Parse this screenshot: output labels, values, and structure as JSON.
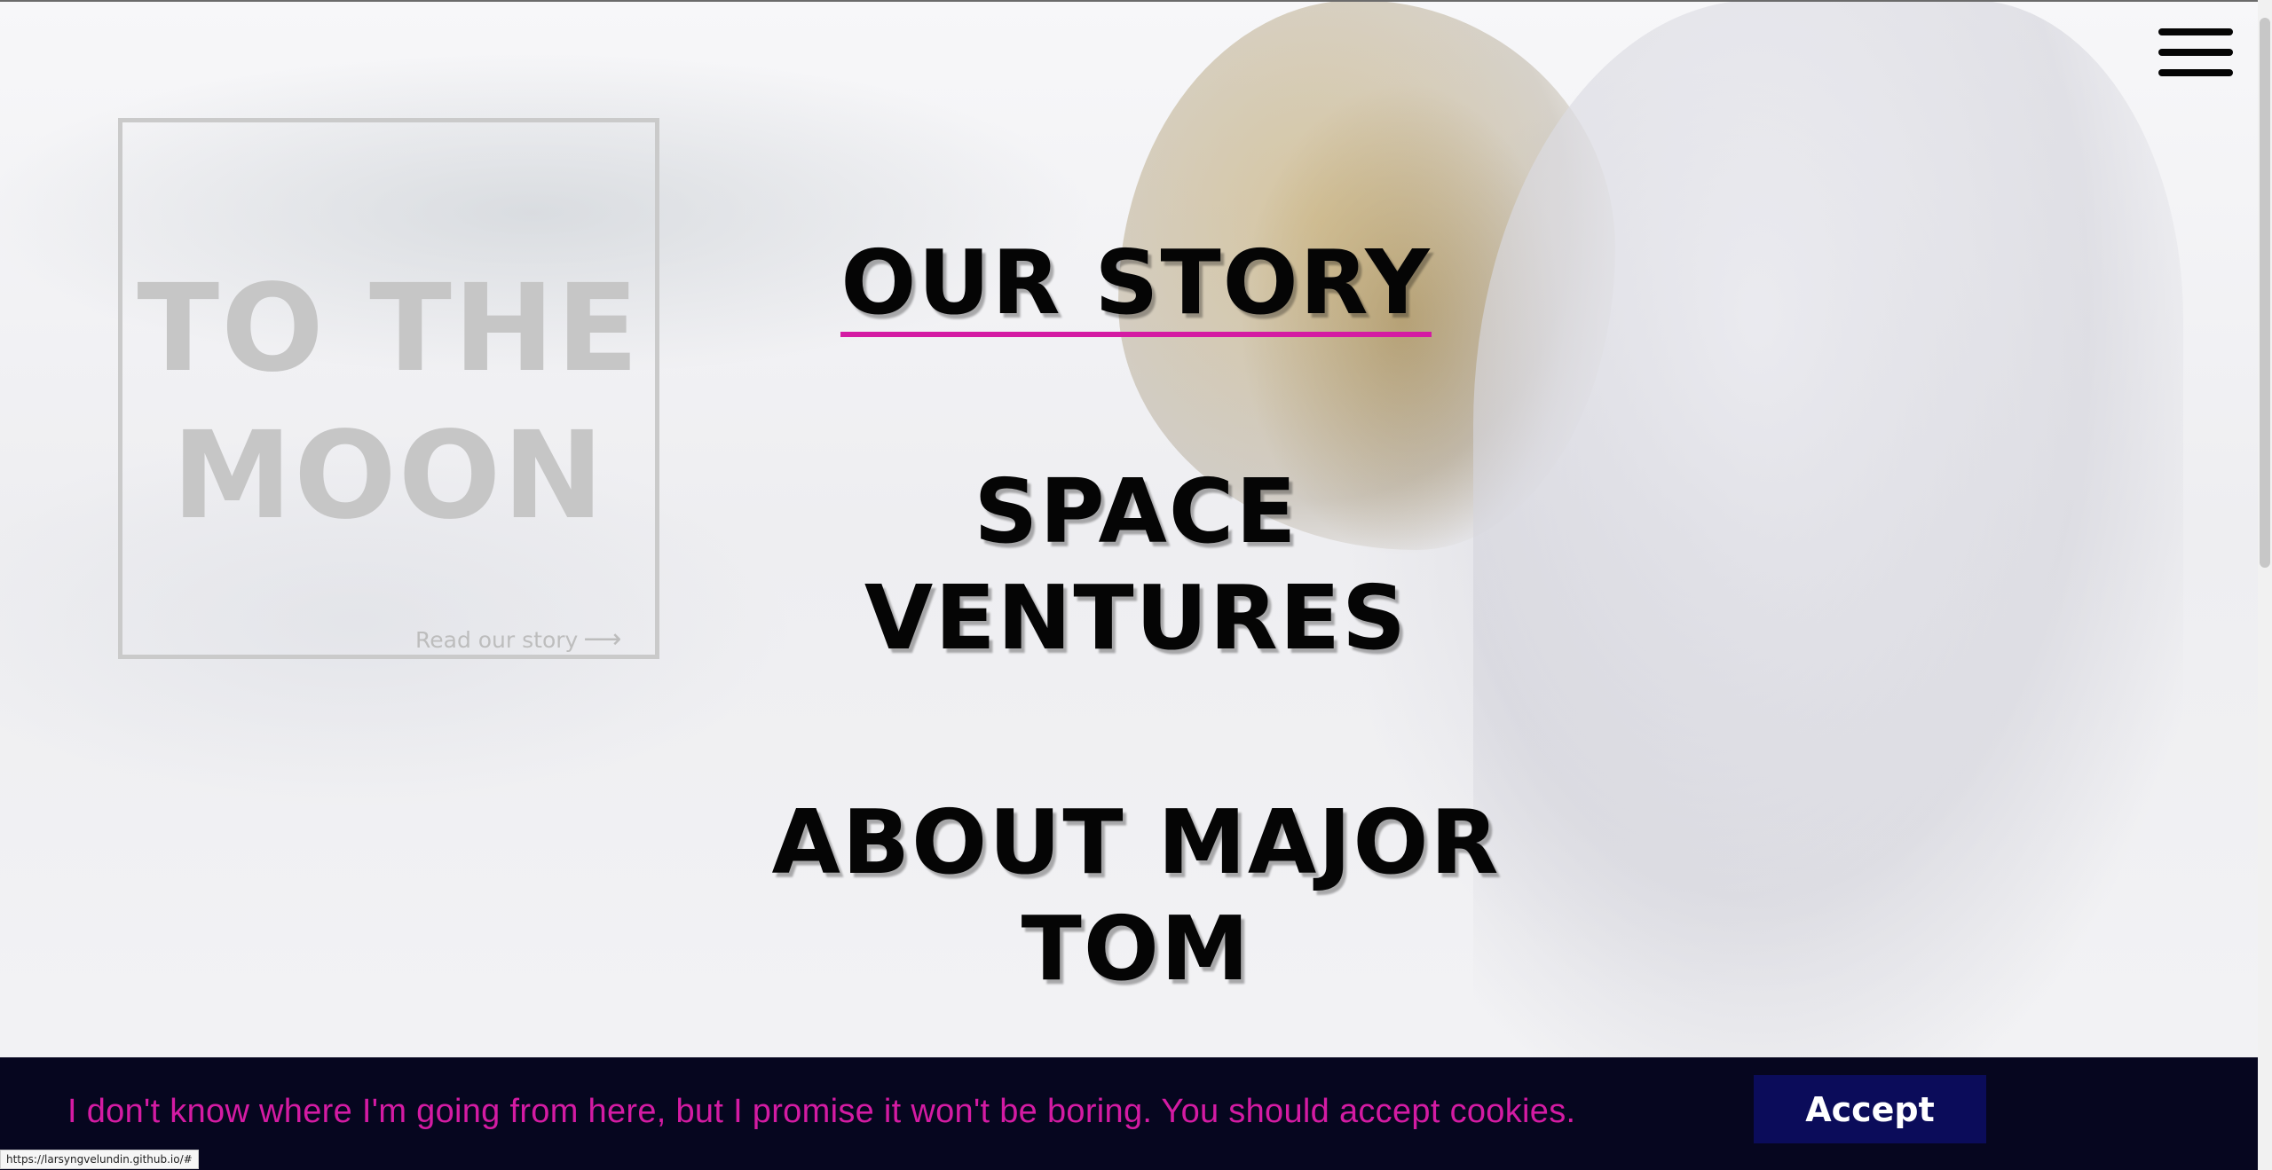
{
  "menu": {
    "icon": "hamburger-menu-icon"
  },
  "hero": {
    "title_line1": "TO THE",
    "title_line2": "MOON",
    "link_label": "Read our story",
    "link_icon": "arrow-right-icon"
  },
  "nav": {
    "items": [
      {
        "line1": "OUR STORY",
        "line2": ""
      },
      {
        "line1": "SPACE",
        "line2": "VENTURES"
      },
      {
        "line1": "ABOUT MAJOR",
        "line2": "TOM"
      }
    ],
    "active_underline_color": "#d41ba3"
  },
  "cookie": {
    "message": "I don't know where I'm going from here, but I promise it won't be boring. You should accept cookies.",
    "accept_label": "Accept",
    "background": "#06061f",
    "text_color": "#d41ba3",
    "button_color": "#0b0c5a"
  },
  "status_bar": {
    "url": "https://larsyngvelundin.github.io/#"
  }
}
